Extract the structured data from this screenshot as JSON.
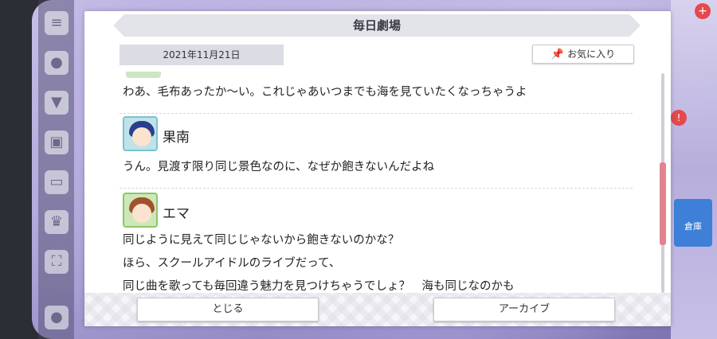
{
  "dialog": {
    "title": "毎日劇場",
    "date": "2021年11月21日",
    "favorite_label": "お気に入り",
    "favorite_icon": "pin-icon"
  },
  "messages": [
    {
      "speaker": "",
      "lines": [
        "わあ、毛布あったか〜い。これじゃあいつまでも海を見ていたくなっちゃうよ"
      ]
    },
    {
      "speaker": "果南",
      "lines": [
        "うん。見渡す限り同じ景色なのに、なぜか飽きないんだよね"
      ]
    },
    {
      "speaker": "エマ",
      "lines": [
        "同じように見えて同じじゃないから飽きないのかな？",
        "ほら、スクールアイドルのライブだって、",
        "同じ曲を歌っても毎回違う魅力を見つけちゃうでしょ？　海も同じなのかも"
      ]
    }
  ],
  "footer": {
    "close_label": "とじる",
    "archive_label": "アーカイブ"
  },
  "side": {
    "right_card_label": "倉庫"
  },
  "colors": {
    "scroll_thumb": "#e2848f",
    "kanan_hair": "#2a3f8f",
    "emma_hair": "#a0512d"
  }
}
